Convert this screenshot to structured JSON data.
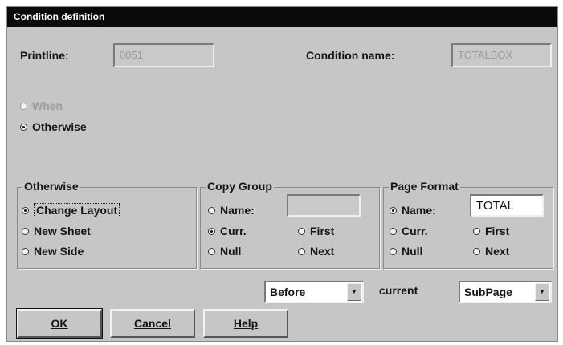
{
  "window": {
    "title": "Condition definition"
  },
  "printline": {
    "label": "Printline:",
    "value": "0051"
  },
  "condition_name": {
    "label": "Condition name:",
    "value": "TOTALBOX"
  },
  "mode": {
    "when_label": "When",
    "otherwise_label": "Otherwise",
    "selected": "otherwise"
  },
  "otherwise_group": {
    "title": "Otherwise",
    "options": [
      "Change Layout",
      "New Sheet",
      "New Side"
    ],
    "selected": "Change Layout"
  },
  "copy_group": {
    "title": "Copy Group",
    "name_label": "Name:",
    "name_value": "",
    "curr_label": "Curr.",
    "first_label": "First",
    "null_label": "Null",
    "next_label": "Next",
    "selected": "Curr."
  },
  "page_format": {
    "title": "Page Format",
    "name_label": "Name:",
    "name_value": "TOTAL",
    "curr_label": "Curr.",
    "first_label": "First",
    "null_label": "Null",
    "next_label": "Next",
    "selected": "Name:"
  },
  "position": {
    "before_value": "Before",
    "current_label": "current",
    "subpage_value": "SubPage",
    "dropdown_icon": "chevron-down-icon"
  },
  "buttons": {
    "ok_label": "OK",
    "cancel_label": "Cancel",
    "help_label": "Help"
  }
}
